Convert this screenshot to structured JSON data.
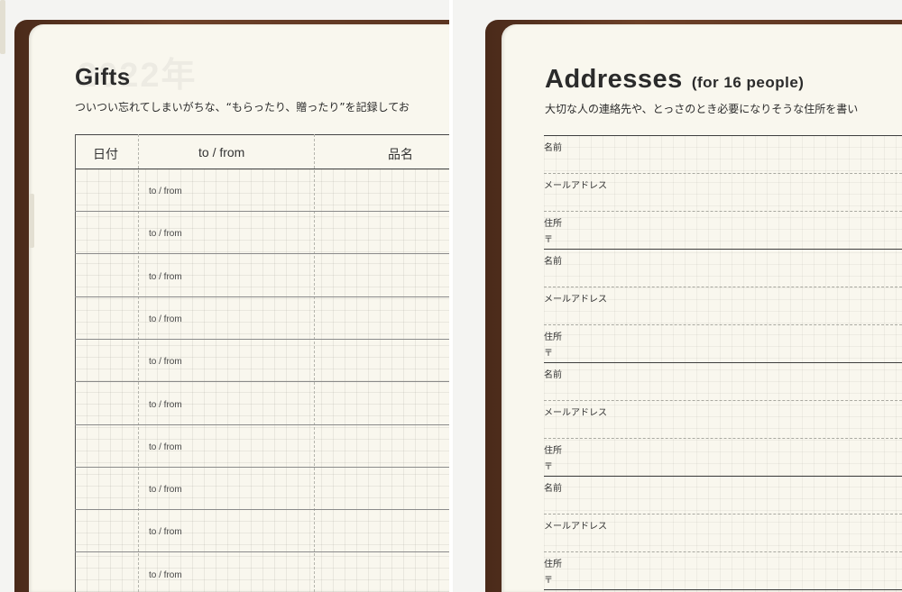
{
  "left_page": {
    "ghost_year": "2022年",
    "title": "Gifts",
    "subtitle": "ついつい忘れてしまいがちな、“もらったり、贈ったり”を記録してお",
    "columns": [
      "日付",
      "to / from",
      "品名"
    ],
    "row_label": "to / from",
    "row_count": 10
  },
  "right_page": {
    "title": "Addresses",
    "title_suffix": "(for 16 people)",
    "subtitle": "大切な人の連絡先や、とっさのとき必要になりそうな住所を書い",
    "fields": {
      "name": "名前",
      "email": "メールアドレス",
      "address": "住所",
      "postal": "〒"
    },
    "entry_count": 4
  }
}
